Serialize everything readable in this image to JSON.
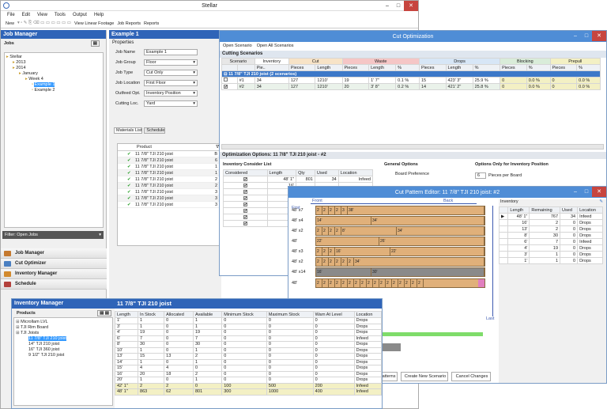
{
  "main": {
    "title": "Stellar",
    "menu": [
      "File",
      "Edit",
      "View",
      "Tools",
      "Output",
      "Help"
    ],
    "toolbar": {
      "new": "New",
      "view_linear": "View Linear Footage",
      "job_reports": "Job Reports",
      "reports": "Reports"
    }
  },
  "job_manager": {
    "title": "Job Manager",
    "jobs_label": "Jobs",
    "filter": "Filter: Open Jobs",
    "tree": [
      "Stellar",
      "2013",
      "2014",
      "January",
      "Week 4",
      "Example 1",
      "Example 2"
    ]
  },
  "nav": {
    "items": [
      "Job Manager",
      "Cut Optimizer",
      "Inventory Manager",
      "Schedule"
    ],
    "extra": "Cu"
  },
  "example": {
    "title": "Example 1",
    "properties": "Properties",
    "labels": [
      "Job Name",
      "Job Group",
      "Job Type",
      "Job Location",
      "Outfeed Opt.",
      "Cutting Loc."
    ],
    "values": [
      "Example 1",
      "Floor",
      "Cut Only",
      "First Floor",
      "Inventory Position",
      "Yard"
    ],
    "tabs": [
      "Materials List",
      "Schedule"
    ],
    "product_header": "Product",
    "products": [
      "11 7/8\" TJI 210 joist",
      "11 7/8\" TJI 210 joist",
      "11 7/8\" TJI 210 joist",
      "11 7/8\" TJI 210 joist",
      "11 7/8\" TJI 210 joist",
      "11 7/8\" TJI 210 joist",
      "11 7/8\" TJI 210 joist",
      "11 7/8\" TJI 210 joist",
      "11 7/8\" TJI 210 joist"
    ],
    "counts": [
      "B",
      "6",
      "1",
      "1",
      "2",
      "2",
      "3",
      "3",
      "3"
    ]
  },
  "cut_opt": {
    "title": "Cut Optimization",
    "open_scenario": "Open Scenario",
    "open_all": "Open All Scenarios",
    "section": "Cutting Scenarios",
    "groups": [
      "Scenario",
      "Inventory",
      "Cut",
      "Waste",
      "Drops",
      "Blocking",
      "Prepull"
    ],
    "sub": [
      "Pie..",
      "Pieces",
      "Length",
      "Pieces",
      "Length",
      "%",
      "Pieces",
      "Length",
      "%",
      "Pieces",
      "%",
      "Pieces",
      "%"
    ],
    "group_row": "11 7/8\" TJI 210 joist (2 scenarios)",
    "rows": [
      [
        "#1",
        "34",
        "127",
        "1210'",
        "19",
        "1' 7\"",
        "0.1 %",
        "15",
        "423' 3\"",
        "25.9 %",
        "0",
        "0.0 %",
        "0",
        "0.0 %"
      ],
      [
        "#2",
        "34",
        "127",
        "1210'",
        "20",
        "3' 8\"",
        "0.2 %",
        "14",
        "421' 2\"",
        "25.8 %",
        "0",
        "0.0 %",
        "0",
        "0.0 %"
      ]
    ],
    "options_label": "Optimization Options: 11 7/8\" TJI 210 joist - #2",
    "inv_consider": "Inventory Consider List",
    "inv_cols": [
      "Considered",
      "Length",
      "Qty",
      "Used",
      "Location"
    ],
    "inv_rows": [
      [
        "48' 1\"",
        "801",
        "34",
        "Infeed"
      ],
      [
        "16'",
        "",
        "",
        ""
      ],
      [
        "13'",
        "",
        "",
        ""
      ],
      [
        "8'",
        "",
        "",
        ""
      ],
      [
        "6'",
        "",
        "",
        ""
      ],
      [
        "4'",
        "",
        "",
        ""
      ],
      [
        "3'",
        "",
        "",
        ""
      ],
      [
        "1'",
        "",
        "",
        ""
      ]
    ],
    "general": "General Options",
    "board_pref": "Board Preference",
    "inv_only": "Options Only for Inventory Position",
    "pieces_per_board": "Pieces per Board",
    "ppb_value": "6",
    "btns": [
      "Patterns",
      "Create New Scenario",
      "Cancel Changes"
    ]
  },
  "cut_pattern": {
    "title": "Cut Pattern Editor: 11 7/8\" TJI 210 joist: #2",
    "front": "Front",
    "back": "Back",
    "first": "First",
    "last": "Last",
    "rows": [
      {
        "label": "48' x7",
        "cuts": [
          "2",
          "2",
          "2",
          "2",
          "3",
          "38'"
        ]
      },
      {
        "label": "48' x4",
        "cuts": [
          "14'",
          "34'"
        ]
      },
      {
        "label": "48' x2",
        "cuts": [
          "2",
          "2",
          "2",
          "2",
          "8'",
          "34'"
        ]
      },
      {
        "label": "48'",
        "cuts": [
          "22'",
          "26'"
        ]
      },
      {
        "label": "48' x3",
        "cuts": [
          "2",
          "2",
          "2",
          "16'",
          "22'"
        ]
      },
      {
        "label": "48' x2",
        "cuts": [
          "2",
          "2",
          "2",
          "2",
          "2",
          "2",
          "34'"
        ]
      },
      {
        "label": "48' x14",
        "cuts": [
          "16'",
          "30'"
        ]
      },
      {
        "label": "48'",
        "cuts": [
          "2",
          "2",
          "2",
          "2",
          "2",
          "2",
          "2",
          "2",
          "2",
          "2",
          "2",
          "2",
          "2",
          "2",
          "2",
          "2",
          "2"
        ]
      }
    ],
    "inventory": "Inventory",
    "inv_cols": [
      "Length",
      "Remaining",
      "Used",
      "Location"
    ],
    "inv_rows": [
      [
        "48' 1\"",
        "767",
        "34",
        "Infeed"
      ],
      [
        "16'",
        "2",
        "0",
        "Drops"
      ],
      [
        "13'",
        "2",
        "0",
        "Drops"
      ],
      [
        "8'",
        "30",
        "0",
        "Drops"
      ],
      [
        "6'",
        "7",
        "0",
        "Infeed"
      ],
      [
        "4'",
        "19",
        "0",
        "Drops"
      ],
      [
        "3'",
        "1",
        "0",
        "Drops"
      ],
      [
        "1'",
        "1",
        "0",
        "Drops"
      ]
    ]
  },
  "inventory_mgr": {
    "title": "Inventory Manager",
    "products_label": "Products",
    "tree": [
      "Microllam LVL",
      "TJI Rim Board",
      "TJI Joists",
      "11 7/8\" TJI 210 joist",
      "14\" TJI 210 joist",
      "16\" TJI 360 joist",
      "9 1/2\" TJI 210 joist"
    ],
    "detail_title": "11 7/8\" TJI 210 joist",
    "cols": [
      "Length",
      "In Stock",
      "Allocated",
      "Available",
      "Minimum Stock",
      "Maximum Stock",
      "Warn At Level",
      "Location"
    ],
    "rows": [
      [
        "1'",
        "1",
        "0",
        "1",
        "0",
        "0",
        "0",
        "Drops"
      ],
      [
        "3'",
        "1",
        "0",
        "1",
        "0",
        "0",
        "0",
        "Drops"
      ],
      [
        "4'",
        "19",
        "0",
        "19",
        "0",
        "0",
        "0",
        "Drops"
      ],
      [
        "6'",
        "7",
        "0",
        "7",
        "0",
        "0",
        "0",
        "Infeed"
      ],
      [
        "8'",
        "30",
        "0",
        "30",
        "0",
        "0",
        "0",
        "Drops"
      ],
      [
        "10'",
        "1",
        "0",
        "1",
        "0",
        "0",
        "0",
        "Drops"
      ],
      [
        "13'",
        "15",
        "13",
        "2",
        "0",
        "0",
        "0",
        "Drops"
      ],
      [
        "14'",
        "1",
        "0",
        "1",
        "0",
        "0",
        "0",
        "Drops"
      ],
      [
        "15'",
        "4",
        "4",
        "0",
        "0",
        "0",
        "0",
        "Drops"
      ],
      [
        "16'",
        "20",
        "18",
        "2",
        "0",
        "0",
        "0",
        "Drops"
      ],
      [
        "20'",
        "1",
        "0",
        "1",
        "0",
        "0",
        "0",
        "Drops"
      ],
      [
        "42' 1\"",
        "2",
        "2",
        "0",
        "100",
        "500",
        "200",
        "Infeed"
      ],
      [
        "48' 1\"",
        "863",
        "62",
        "801",
        "300",
        "1000",
        "400",
        "Infeed"
      ]
    ]
  }
}
